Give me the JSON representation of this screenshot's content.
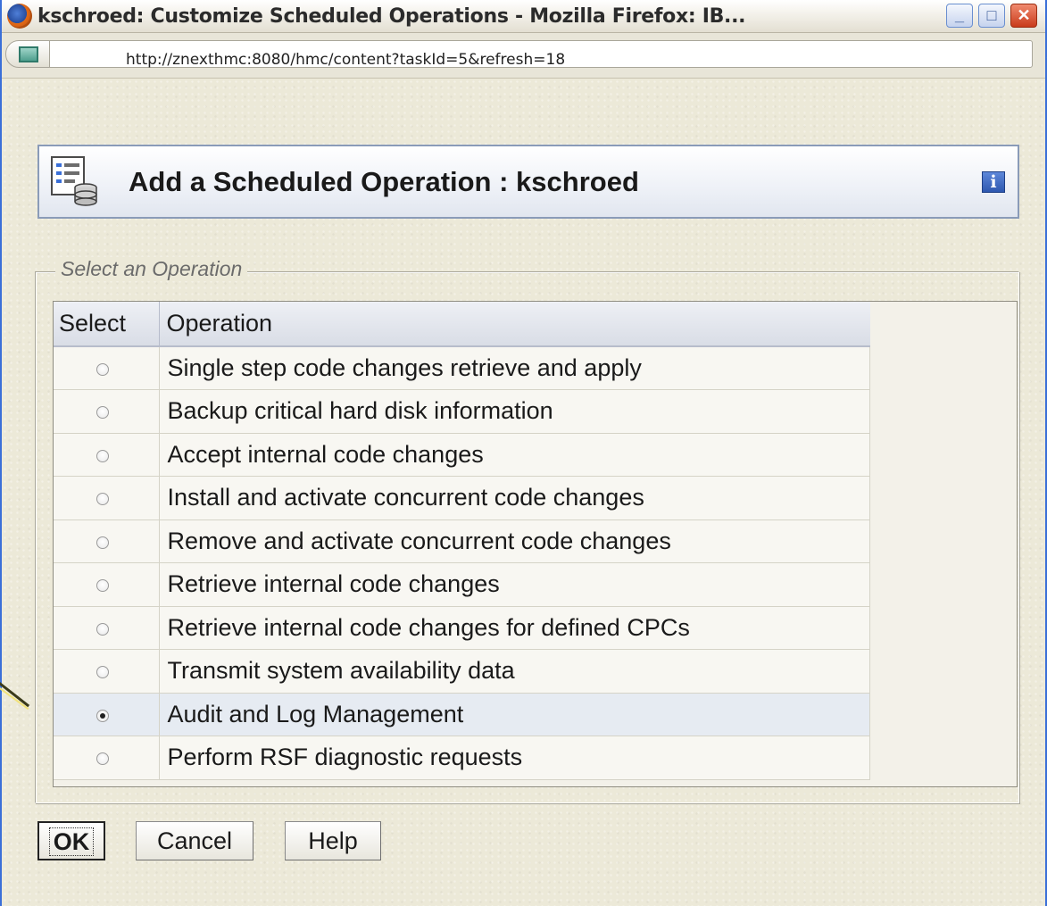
{
  "window": {
    "title": "kschroed: Customize Scheduled Operations - Mozilla Firefox: IB...",
    "minimize": "_",
    "maximize": "□",
    "close": "✕"
  },
  "browser": {
    "url": "http://znexthmc:8080/hmc/content?taskId=5&refresh=18",
    "bookmark_icon": "star-icon"
  },
  "header": {
    "title": "Add a Scheduled Operation : kschroed",
    "info": "i"
  },
  "panel": {
    "legend": "Select an Operation",
    "columns": [
      "Select",
      "Operation"
    ],
    "rows": [
      {
        "operation": "Single step code changes retrieve and apply",
        "selected": false
      },
      {
        "operation": "Backup critical hard disk information",
        "selected": false
      },
      {
        "operation": "Accept internal code changes",
        "selected": false
      },
      {
        "operation": "Install and activate concurrent code changes",
        "selected": false
      },
      {
        "operation": "Remove and activate concurrent code changes",
        "selected": false
      },
      {
        "operation": "Retrieve internal code changes",
        "selected": false
      },
      {
        "operation": "Retrieve internal code changes for defined CPCs",
        "selected": false
      },
      {
        "operation": "Transmit system availability data",
        "selected": false
      },
      {
        "operation": "Audit and Log Management",
        "selected": true
      },
      {
        "operation": "Perform RSF diagnostic requests",
        "selected": false
      }
    ]
  },
  "buttons": {
    "ok": "OK",
    "cancel": "Cancel",
    "help": "Help"
  }
}
